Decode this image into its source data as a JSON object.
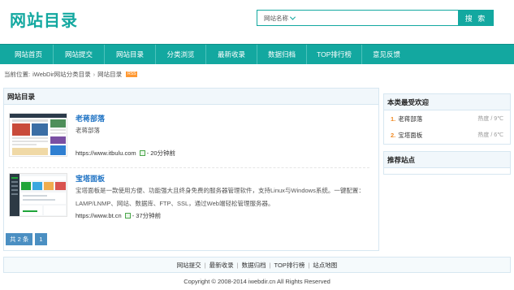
{
  "header": {
    "logo": "网站目录",
    "search": {
      "select_value": "网站名称",
      "placeholder": "",
      "button_label": "搜 索"
    }
  },
  "nav": {
    "items": [
      {
        "label": "网站首页"
      },
      {
        "label": "网站提交"
      },
      {
        "label": "网站目录"
      },
      {
        "label": "分类浏览"
      },
      {
        "label": "最新收录"
      },
      {
        "label": "数据归档"
      },
      {
        "label": "TOP排行榜"
      },
      {
        "label": "意见反馈"
      }
    ]
  },
  "breadcrumb": {
    "prefix": "当前位置:",
    "home": "iWebDir网站分类目录",
    "separator": "›",
    "current": "网站目录",
    "tag": "RSS"
  },
  "main": {
    "title": "网站目录",
    "sites": [
      {
        "name": "老蒋部落",
        "desc": "老蒋部落",
        "url": "https://www.itbulu.com",
        "time": "- 20分钟前"
      },
      {
        "name": "宝塔面板",
        "desc": "宝塔面板是一款使用方便、功能强大且终身免费的服务器管理软件，支持Linux与Windows系统。一键配置：LAMP/LNMP、网站、数据库、FTP、SSL，通过Web端轻松管理服务器。",
        "url": "https://www.bt.cn",
        "time": "- 37分钟前"
      }
    ],
    "pager": {
      "total": "共 2 条",
      "page": "1"
    }
  },
  "sidebar": {
    "popular": {
      "title": "本类最受欢迎",
      "items": [
        {
          "rank": "1.",
          "name": "老蒋部落",
          "heat": "热度 / 9℃"
        },
        {
          "rank": "2.",
          "name": "宝塔面板",
          "heat": "热度 / 6℃"
        }
      ]
    },
    "recommend": {
      "title": "推荐站点"
    }
  },
  "footer": {
    "links": [
      "网站提交",
      "最新收录",
      "数据归档",
      "TOP排行榜",
      "站点地图"
    ],
    "separator": "|",
    "copyright": "Copyright © 2008-2014 iwebdir.cn All Rights Reserved"
  },
  "colors": {
    "accent": "#13a8a0",
    "link": "#1f73c4",
    "pager": "#4b8fc2",
    "rank": "#f08a24"
  }
}
